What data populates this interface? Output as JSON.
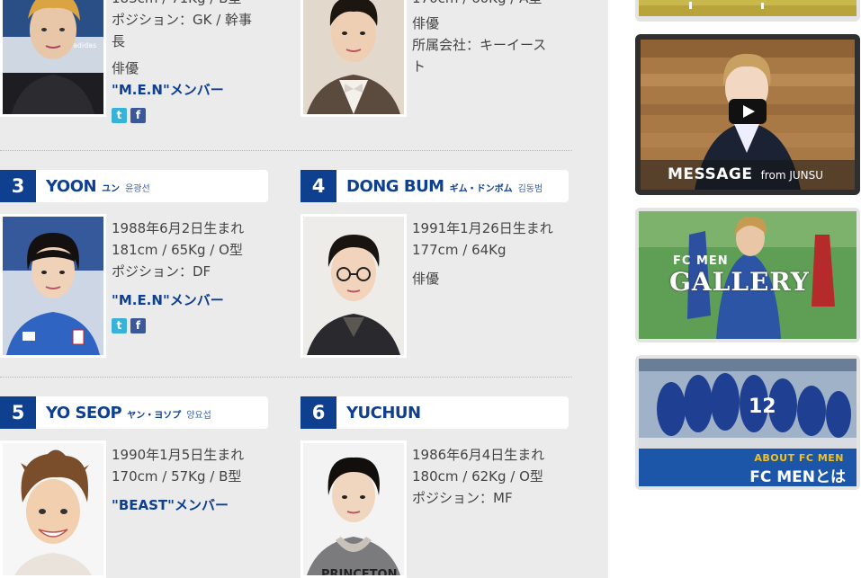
{
  "members": [
    {
      "num": "1",
      "info": [
        "ポジション：GK / 幹事",
        "長"
      ],
      "job": "俳優",
      "group": "\"M.E.N\"メンバー",
      "partial_top": "183cm / 71Kg / B型"
    },
    {
      "num": "2",
      "info": [
        "170cm / 60Kg / A型"
      ],
      "job": "俳優",
      "agency": [
        "所属会社：キーイース",
        "ト"
      ]
    },
    {
      "num": "3",
      "name_en": "YOON",
      "name_kana": "ユン",
      "name_ko": "윤광선",
      "info": [
        "1988年6月2日生まれ",
        "181cm / 65Kg / O型",
        "ポジション：DF"
      ],
      "group": "\"M.E.N\"メンバー"
    },
    {
      "num": "4",
      "name_en": "DONG BUM",
      "name_kana": "ギム・ドンボム",
      "name_ko": "김동범",
      "info": [
        "1991年1月26日生まれ",
        "177cm / 64Kg"
      ],
      "job": "俳優"
    },
    {
      "num": "5",
      "name_en": "YO SEOP",
      "name_kana": "ヤン・ヨソプ",
      "name_ko": "양요섭",
      "info": [
        "1990年1月5日生まれ",
        "170cm / 57Kg / B型"
      ],
      "group": "\"BEAST\"メンバー"
    },
    {
      "num": "6",
      "name_en": "YUCHUN",
      "info": [
        "1986年6月4日生まれ",
        "180cm / 62Kg / O型",
        "ポジション：MF"
      ]
    }
  ],
  "sns": {
    "twitter": "t",
    "facebook": "f"
  },
  "sidebar": {
    "message": {
      "title": "MESSAGE",
      "from": "from JUNSU"
    },
    "gallery": {
      "sub": "FC MEN",
      "title": "GALLERY"
    },
    "about": {
      "sub": "ABOUT FC MEN",
      "title": "FC MENとは"
    }
  },
  "colors": {
    "navy": "#0f3f8f",
    "page_bg": "#ebebeb",
    "twitter": "#39b2d9",
    "facebook": "#3b5998"
  }
}
